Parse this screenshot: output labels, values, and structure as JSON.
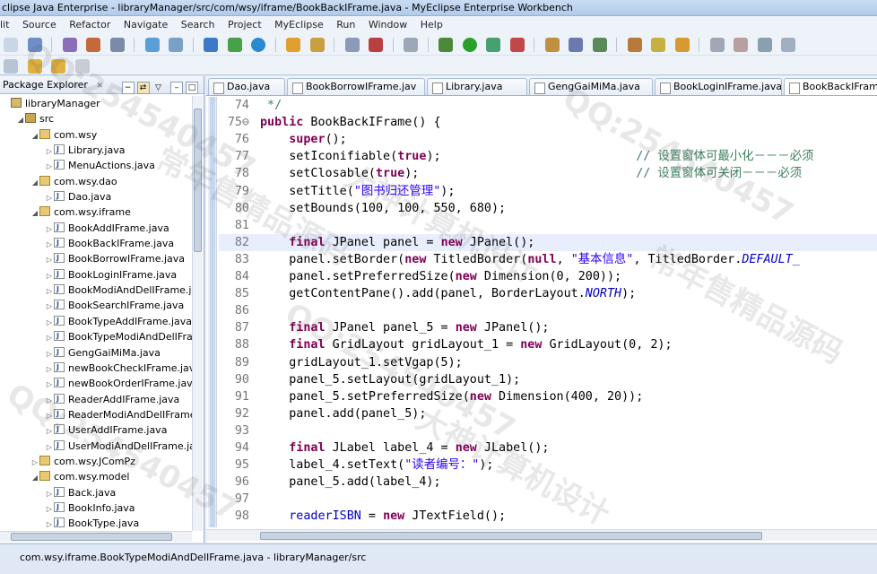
{
  "window": {
    "title": "clipse Java Enterprise - libraryManager/src/com/wsy/iframe/BookBackIFrame.java - MyEclipse Enterprise Workbench"
  },
  "menu": [
    "lit",
    "Source",
    "Refactor",
    "Navigate",
    "Search",
    "Project",
    "MyEclipse",
    "Run",
    "Window",
    "Help"
  ],
  "package_explorer": {
    "title": "Package Explorer",
    "close_glyph": "✕",
    "tree": [
      {
        "label": "libraryManager",
        "indent": 0,
        "icon": "project-icon",
        "twisty": ""
      },
      {
        "label": "src",
        "indent": 1,
        "icon": "source-folder-icon",
        "twisty": "◢"
      },
      {
        "label": "com.wsy",
        "indent": 2,
        "icon": "package-icon",
        "twisty": "◢"
      },
      {
        "label": "Library.java",
        "indent": 3,
        "icon": "java-file-icon",
        "twisty": "▷"
      },
      {
        "label": "MenuActions.java",
        "indent": 3,
        "icon": "java-file-icon",
        "twisty": "▷"
      },
      {
        "label": "com.wsy.dao",
        "indent": 2,
        "icon": "package-icon",
        "twisty": "◢"
      },
      {
        "label": "Dao.java",
        "indent": 3,
        "icon": "java-file-icon",
        "twisty": "▷"
      },
      {
        "label": "com.wsy.iframe",
        "indent": 2,
        "icon": "package-icon",
        "twisty": "◢"
      },
      {
        "label": "BookAddIFrame.java",
        "indent": 3,
        "icon": "java-file-icon",
        "twisty": "▷"
      },
      {
        "label": "BookBackIFrame.java",
        "indent": 3,
        "icon": "java-file-icon",
        "twisty": "▷"
      },
      {
        "label": "BookBorrowIFrame.java",
        "indent": 3,
        "icon": "java-file-icon",
        "twisty": "▷"
      },
      {
        "label": "BookLoginIFrame.java",
        "indent": 3,
        "icon": "java-file-icon",
        "twisty": "▷"
      },
      {
        "label": "BookModiAndDelIFrame.jav",
        "indent": 3,
        "icon": "java-file-icon",
        "twisty": "▷"
      },
      {
        "label": "BookSearchIFrame.java",
        "indent": 3,
        "icon": "java-file-icon",
        "twisty": "▷"
      },
      {
        "label": "BookTypeAddIFrame.java",
        "indent": 3,
        "icon": "java-file-icon",
        "twisty": "▷"
      },
      {
        "label": "BookTypeModiAndDelIFram",
        "indent": 3,
        "icon": "java-file-icon",
        "twisty": "▷"
      },
      {
        "label": "GengGaiMiMa.java",
        "indent": 3,
        "icon": "java-file-icon",
        "twisty": "▷"
      },
      {
        "label": "newBookCheckIFrame.java",
        "indent": 3,
        "icon": "java-file-icon",
        "twisty": "▷"
      },
      {
        "label": "newBookOrderIFrame.java",
        "indent": 3,
        "icon": "java-file-icon",
        "twisty": "▷"
      },
      {
        "label": "ReaderAddIFrame.java",
        "indent": 3,
        "icon": "java-file-icon",
        "twisty": "▷"
      },
      {
        "label": "ReaderModiAndDelIFrame.j",
        "indent": 3,
        "icon": "java-file-icon",
        "twisty": "▷"
      },
      {
        "label": "UserAddIFrame.java",
        "indent": 3,
        "icon": "java-file-icon",
        "twisty": "▷"
      },
      {
        "label": "UserModiAndDelIFrame.jav",
        "indent": 3,
        "icon": "java-file-icon",
        "twisty": "▷"
      },
      {
        "label": "com.wsy.JComPz",
        "indent": 2,
        "icon": "package-icon",
        "twisty": "▷"
      },
      {
        "label": "com.wsy.model",
        "indent": 2,
        "icon": "package-icon",
        "twisty": "◢"
      },
      {
        "label": "Back.java",
        "indent": 3,
        "icon": "java-file-icon",
        "twisty": "▷"
      },
      {
        "label": "BookInfo.java",
        "indent": 3,
        "icon": "java-file-icon",
        "twisty": "▷"
      },
      {
        "label": "BookType.java",
        "indent": 3,
        "icon": "java-file-icon",
        "twisty": "▷"
      }
    ]
  },
  "editor": {
    "tabs": [
      {
        "label": "Dao.java",
        "active": false
      },
      {
        "label": "BookBorrowIFrame.jav",
        "active": false
      },
      {
        "label": "Library.java",
        "active": false
      },
      {
        "label": "GengGaiMiMa.java",
        "active": false
      },
      {
        "label": "BookLoginIFrame.java",
        "active": false
      },
      {
        "label": "BookBackIFrame",
        "active": true
      }
    ],
    "current_line": 82,
    "lines": [
      {
        "n": "74",
        "code": [
          [
            "cmt",
            " */"
          ]
        ]
      },
      {
        "n": "75⊖",
        "code": [
          [
            "kw",
            "public"
          ],
          [
            "",
            " BookBackIFrame() {"
          ]
        ]
      },
      {
        "n": "76",
        "code": [
          [
            "",
            "    "
          ],
          [
            "kw",
            "super"
          ],
          [
            "",
            "();"
          ]
        ]
      },
      {
        "n": "77",
        "code": [
          [
            "",
            "    setIconifiable("
          ],
          [
            "kw",
            "true"
          ],
          [
            "",
            ");                           "
          ],
          [
            "cmt",
            "// 设置窗体可最小化－－－必须"
          ]
        ]
      },
      {
        "n": "78",
        "code": [
          [
            "",
            "    setClosable("
          ],
          [
            "kw",
            "true"
          ],
          [
            "",
            ");                              "
          ],
          [
            "cmt",
            "// 设置窗体可关闭－－－必须"
          ]
        ]
      },
      {
        "n": "79",
        "code": [
          [
            "",
            "    setTitle("
          ],
          [
            "str",
            "\"图书归还管理\""
          ],
          [
            "",
            ");"
          ]
        ]
      },
      {
        "n": "80",
        "code": [
          [
            "",
            "    setBounds(100, 100, 550, 680);"
          ]
        ]
      },
      {
        "n": "81",
        "code": [
          [
            "",
            ""
          ]
        ]
      },
      {
        "n": "82",
        "code": [
          [
            "",
            "    "
          ],
          [
            "kw",
            "final"
          ],
          [
            "",
            " JPanel panel = "
          ],
          [
            "kw",
            "new"
          ],
          [
            "",
            " JPanel();"
          ]
        ]
      },
      {
        "n": "83",
        "code": [
          [
            "",
            "    panel.setBorder("
          ],
          [
            "kw",
            "new"
          ],
          [
            "",
            " TitledBorder("
          ],
          [
            "kw",
            "null"
          ],
          [
            "",
            ", "
          ],
          [
            "str",
            "\"基本信息\""
          ],
          [
            "",
            ", TitledBorder."
          ],
          [
            "fld",
            "DEFAULT_"
          ]
        ]
      },
      {
        "n": "84",
        "code": [
          [
            "",
            "    panel.setPreferredSize("
          ],
          [
            "kw",
            "new"
          ],
          [
            "",
            " Dimension(0, 200));"
          ]
        ]
      },
      {
        "n": "85",
        "code": [
          [
            "",
            "    getContentPane().add(panel, BorderLayout."
          ],
          [
            "fld",
            "NORTH"
          ],
          [
            "",
            ");"
          ]
        ]
      },
      {
        "n": "86",
        "code": [
          [
            "",
            ""
          ]
        ]
      },
      {
        "n": "87",
        "code": [
          [
            "",
            "    "
          ],
          [
            "kw",
            "final"
          ],
          [
            "",
            " JPanel panel_5 = "
          ],
          [
            "kw",
            "new"
          ],
          [
            "",
            " JPanel();"
          ]
        ]
      },
      {
        "n": "88",
        "code": [
          [
            "",
            "    "
          ],
          [
            "kw",
            "final"
          ],
          [
            "",
            " GridLayout gridLayout_1 = "
          ],
          [
            "kw",
            "new"
          ],
          [
            "",
            " GridLayout(0, 2);"
          ]
        ]
      },
      {
        "n": "89",
        "code": [
          [
            "",
            "    gridLayout_1.setVgap(5);"
          ]
        ]
      },
      {
        "n": "90",
        "code": [
          [
            "",
            "    panel_5.setLayout(gridLayout_1);"
          ]
        ]
      },
      {
        "n": "91",
        "code": [
          [
            "",
            "    panel_5.setPreferredSize("
          ],
          [
            "kw",
            "new"
          ],
          [
            "",
            " Dimension(400, 20));"
          ]
        ]
      },
      {
        "n": "92",
        "code": [
          [
            "",
            "    panel.add(panel_5);"
          ]
        ]
      },
      {
        "n": "93",
        "code": [
          [
            "",
            ""
          ]
        ]
      },
      {
        "n": "94",
        "code": [
          [
            "",
            "    "
          ],
          [
            "kw",
            "final"
          ],
          [
            "",
            " JLabel label_4 = "
          ],
          [
            "kw",
            "new"
          ],
          [
            "",
            " JLabel();"
          ]
        ]
      },
      {
        "n": "95",
        "code": [
          [
            "",
            "    label_4.setText("
          ],
          [
            "str",
            "\"读者编号：\""
          ],
          [
            "",
            ");"
          ]
        ]
      },
      {
        "n": "96",
        "code": [
          [
            "",
            "    panel_5.add(label_4);"
          ]
        ]
      },
      {
        "n": "97",
        "code": [
          [
            "",
            ""
          ]
        ]
      },
      {
        "n": "98",
        "code": [
          [
            "",
            "    "
          ],
          [
            "fld2",
            "readerISBN"
          ],
          [
            "",
            " = "
          ],
          [
            "kw",
            "new"
          ],
          [
            "",
            " JTextField();"
          ]
        ]
      }
    ]
  },
  "statusbar": {
    "text": "com.wsy.iframe.BookTypeModiAndDelIFrame.java - libraryManager/src"
  },
  "watermarks": [
    "QQ:254540457",
    "常年售精品源码",
    "大神计算机设计",
    "QQ:254540457",
    "常年售精品源码",
    "QQ:254540457",
    "大神计算机设计",
    "QQ:254540457"
  ],
  "toolbar_icons": [
    "new-icon",
    "save-icon",
    "print-icon",
    "build-icon",
    "package-icon",
    "deploy-icon",
    "server-icon",
    "web-icon",
    "open-type-icon",
    "search-icon",
    "debug-icon",
    "run-icon",
    "run-external-icon",
    "coverage-icon",
    "new-class-icon",
    "new-package-icon",
    "open-file-icon",
    "task-icon",
    "annotation-icon",
    "next-annotation-icon",
    "back-icon",
    "forward-icon"
  ]
}
